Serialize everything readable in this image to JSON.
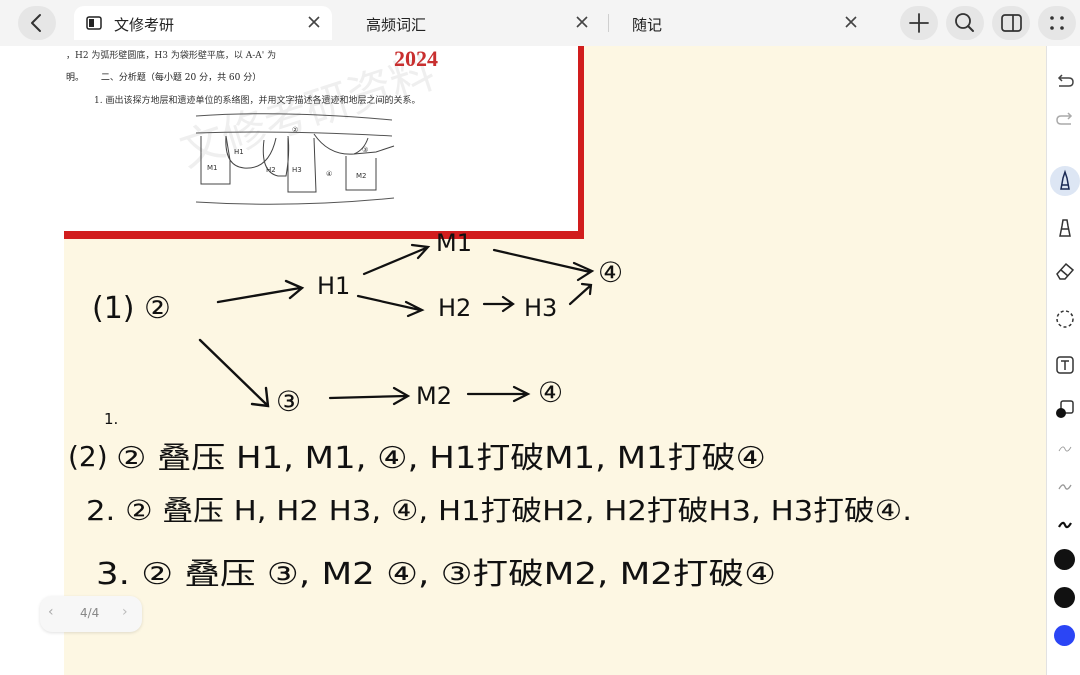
{
  "tabs": [
    {
      "label": "文修考研",
      "active": true
    },
    {
      "label": "高频词汇",
      "active": false
    },
    {
      "label": "随记",
      "active": false
    }
  ],
  "icons": {
    "back": "chevron-left-icon",
    "add_tab": "plus-icon",
    "search": "search-icon",
    "sidebar": "sidebar-icon",
    "more": "grid-dots-icon"
  },
  "document": {
    "line1": "，H2 为弧形壁圆底，H3 为袋形壁平底，以 A-A' 为",
    "year": "2024",
    "heading_prefix": "明。",
    "heading": "二、分析题（每小题 20 分，共 60 分）",
    "question": "1. 画出该探方地层和遗迹单位的系络图，并用文字描述各遗迹和地层之间的关系。",
    "figure_labels": [
      "②",
      "H1",
      "H2",
      "H3",
      "M1",
      "④",
      "③",
      "M2"
    ]
  },
  "handwriting": {
    "diagram_start": "(1) ②",
    "diagram_nodes": [
      "H1",
      "M1",
      "H2",
      "H3",
      "④",
      "③",
      "M2",
      "④"
    ],
    "part2_label": "(2)",
    "numeral_1": "1.",
    "line1": "② 叠压 H1, M1, ④, H1打破M1, M1打破④",
    "line2": "2. ② 叠压 H, H2 H3, ④, H1打破H2, H2打破H3, H3打破④.",
    "line3": "3. ② 叠压 ③, M2 ④, ③打破M2, M2打破④"
  },
  "pager": {
    "label": "4/4"
  },
  "toolbar": {
    "tools": [
      "undo-icon",
      "redo-icon",
      "pen-icon",
      "highlighter-icon",
      "eraser-icon",
      "lasso-icon",
      "text-icon",
      "shape-icon",
      "stroke-thin-icon",
      "stroke-medium-icon",
      "stroke-thick-icon"
    ],
    "colors": [
      "#111111",
      "#111111",
      "#2b45f5"
    ]
  }
}
